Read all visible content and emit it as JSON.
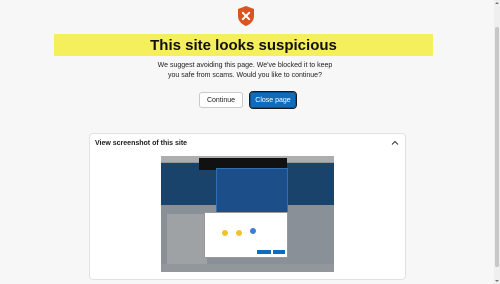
{
  "warning": {
    "title": "This site looks suspicious",
    "message_line1": "We suggest avoiding this page. We've blocked it to keep",
    "message_line2": "you safe from scams. Would you like to continue?",
    "accent_color": "#d9541e",
    "banner_color": "#f6ef5c",
    "icon": "shield-x-icon"
  },
  "actions": {
    "continue_label": "Continue",
    "close_label": "Close page",
    "primary_color": "#0f6cbd"
  },
  "screenshot_section": {
    "title": "View screenshot of this site",
    "expanded": true,
    "toggle_icon": "chevron-up-icon"
  }
}
